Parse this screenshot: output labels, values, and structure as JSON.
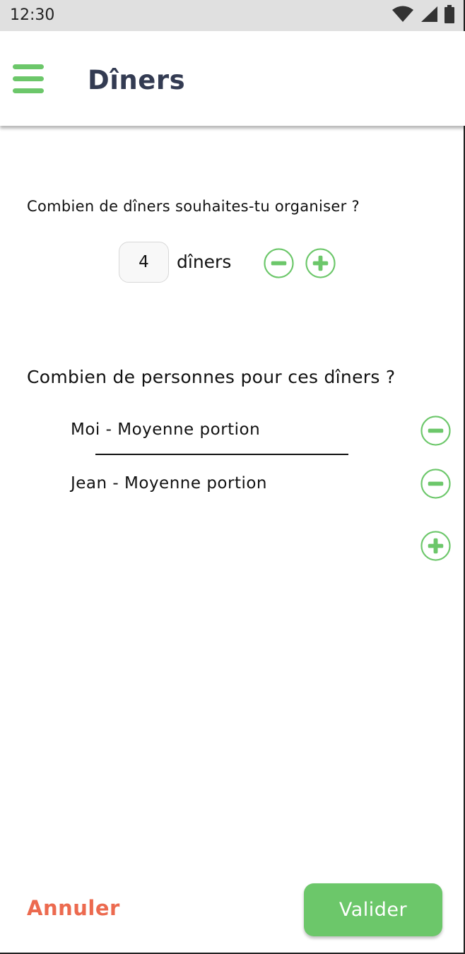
{
  "status_bar": {
    "time": "12:30",
    "icons": [
      "wifi-icon",
      "cell-signal-icon",
      "battery-icon"
    ]
  },
  "app_bar": {
    "title": "Dîners",
    "menu_icon": "hamburger-menu-icon"
  },
  "dinners": {
    "question": "Combien de dîners souhaites-tu organiser ?",
    "count": "4",
    "unit": "dîners"
  },
  "people": {
    "question": "Combien de personnes pour ces dîners ?",
    "items": [
      {
        "label": "Moi - Moyenne portion"
      },
      {
        "label": "Jean - Moyenne portion"
      }
    ]
  },
  "actions": {
    "cancel_label": "Annuler",
    "validate_label": "Valider"
  },
  "colors": {
    "accent_green": "#6cc76a",
    "title_navy": "#333b52",
    "cancel_orange": "#ec6a4f"
  }
}
